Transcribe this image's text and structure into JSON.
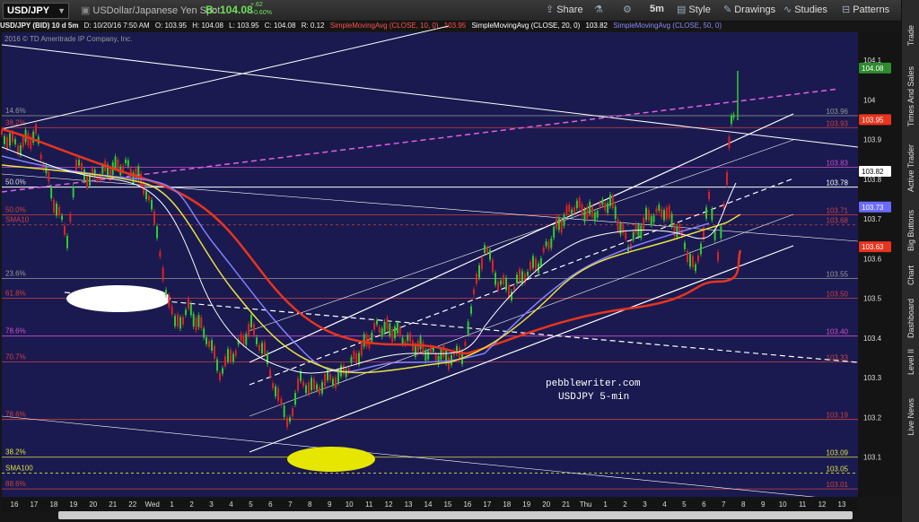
{
  "toolbar": {
    "symbol": "USD/JPY",
    "description": "USDollar/Japanese Yen Spot",
    "last_price": "B: 104.08",
    "change": "+.62",
    "change_pct": "+0.60%",
    "share_label": "Share",
    "interval_label": "5m",
    "style_label": "Style",
    "drawings_label": "Drawings",
    "studies_label": "Studies",
    "patterns_label": "Patterns"
  },
  "status": {
    "symbol_info": "USD/JPY (BID) 10 d 5m",
    "date": "D: 10/20/16 7:50 AM",
    "open": "O: 103.95",
    "high": "H: 104.08",
    "low": "L: 103.95",
    "close": "C: 104.08",
    "range": "R: 0.12",
    "sma10_label": "SimpleMovingAvg (CLOSE, 10, 0)",
    "sma10_val": "103.95",
    "sma20_label": "SimpleMovingAvg (CLOSE, 20, 0)",
    "sma20_val": "103.82",
    "sma50_label": "SimpleMovingAvg (CLOSE, 50, 0)"
  },
  "copyright": "2016 © TD Ameritrade IP Company, Inc.",
  "annotation": {
    "line1": "pebblewriter.com",
    "line2": "USDJPY 5-min"
  },
  "sidebar": [
    "Trade",
    "Times And Sales",
    "Active Trader",
    "Big Buttons",
    "Chart",
    "Dashboard",
    "Level II",
    "Live News"
  ],
  "colors": {
    "chart_bg": "#1a1a50",
    "sma10": "#e8341e",
    "sma20": "#ffffff",
    "sma50": "#8080ff",
    "sma100": "#e8e040",
    "highlight": "#ffffff",
    "yellow_oval": "#e6e600",
    "pink_dash": "#e060e0"
  },
  "chart_data": {
    "type": "candlestick",
    "y_range": [
      103.0,
      104.17
    ],
    "y_ticks": [
      "104.1",
      "104",
      "103.9",
      "103.8",
      "103.7",
      "103.6",
      "103.5",
      "103.4",
      "103.3",
      "103.2",
      "103.1"
    ],
    "y_tick_values": [
      104.1,
      104.0,
      103.9,
      103.8,
      103.7,
      103.6,
      103.5,
      103.4,
      103.3,
      103.2,
      103.1
    ],
    "x_ticks": [
      "16",
      "17",
      "18",
      "19",
      "20",
      "21",
      "22",
      "Wed",
      "1",
      "2",
      "3",
      "4",
      "5",
      "6",
      "7",
      "8",
      "9",
      "10",
      "11",
      "12",
      "13",
      "14",
      "15",
      "16",
      "17",
      "18",
      "19",
      "20",
      "21",
      "Thu",
      "1",
      "2",
      "3",
      "4",
      "5",
      "6",
      "7",
      "8",
      "9",
      "10",
      "11",
      "12",
      "13"
    ],
    "h_levels": [
      {
        "left_label": "14.6%",
        "right_label": "103.96",
        "value": 103.96,
        "color": "#999999",
        "style": "solid"
      },
      {
        "left_label": "38.2%",
        "right_label": "103.93",
        "value": 103.93,
        "color": "#d04040",
        "style": "solid"
      },
      {
        "left_label": "",
        "right_label": "103.83",
        "value": 103.83,
        "color": "#d050d0",
        "style": "solid"
      },
      {
        "left_label": "50.0%",
        "right_label": "103.78",
        "value": 103.78,
        "color": "#ffffff",
        "style": "solid"
      },
      {
        "left_label": "50.0%",
        "right_label": "103.71",
        "value": 103.71,
        "color": "#d04040",
        "style": "solid"
      },
      {
        "left_label": "SMA10",
        "right_label": "103.68",
        "value": 103.685,
        "color": "#d04040",
        "style": "dashed"
      },
      {
        "left_label": "23.6%",
        "right_label": "103.55",
        "value": 103.55,
        "color": "#999999",
        "style": "solid"
      },
      {
        "left_label": "61.8%",
        "right_label": "103.50",
        "value": 103.5,
        "color": "#d04040",
        "style": "solid"
      },
      {
        "left_label": "78.6%",
        "right_label": "103.40",
        "value": 103.405,
        "color": "#d050d0",
        "style": "solid"
      },
      {
        "left_label": "70.7%",
        "right_label": "103.33",
        "value": 103.34,
        "color": "#d04040",
        "style": "solid"
      },
      {
        "left_label": "78.6%",
        "right_label": "103.19",
        "value": 103.195,
        "color": "#d04040",
        "style": "solid"
      },
      {
        "left_label": "38.2%",
        "right_label": "103.09",
        "value": 103.1,
        "color": "#e0e040",
        "style": "solid"
      },
      {
        "left_label": "SMA100",
        "right_label": "103.05",
        "value": 103.06,
        "color": "#e0e040",
        "style": "dashed"
      },
      {
        "left_label": "88.6%",
        "right_label": "103.01",
        "value": 103.02,
        "color": "#d04040",
        "style": "solid"
      }
    ],
    "price_tags": [
      {
        "label": "104.08",
        "value": 104.08,
        "bg": "#2e8b2e",
        "fg": "#ffffff"
      },
      {
        "label": "103.95",
        "value": 103.95,
        "bg": "#e8341e",
        "fg": "#ffffff"
      },
      {
        "label": "103.82",
        "value": 103.82,
        "bg": "#ffffff",
        "fg": "#000000"
      },
      {
        "label": "103.73",
        "value": 103.73,
        "bg": "#6a6aff",
        "fg": "#ffffff"
      },
      {
        "label": "103.63",
        "value": 103.63,
        "bg": "#e8341e",
        "fg": "#ffffff"
      }
    ]
  }
}
